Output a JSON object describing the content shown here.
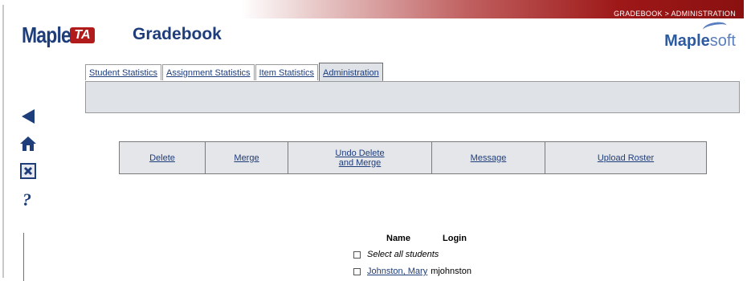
{
  "header": {
    "breadcrumb": "GRADEBOOK > ADMINISTRATION",
    "logo_text": "Maple",
    "logo_badge": "TA",
    "title": "Gradebook",
    "brand_bold": "Maple",
    "brand_rest": "soft"
  },
  "tabs": [
    {
      "label": "Student Statistics"
    },
    {
      "label": "Assignment Statistics"
    },
    {
      "label": "Item Statistics"
    },
    {
      "label": "Administration",
      "active": true
    }
  ],
  "sidebar": {
    "icons": [
      "back-icon",
      "home-icon",
      "close-icon",
      "help-icon"
    ]
  },
  "actions": [
    {
      "label": "Delete"
    },
    {
      "label": "Merge"
    },
    {
      "line1": "Undo Delete",
      "line2": "and Merge"
    },
    {
      "label": "Message"
    },
    {
      "label": "Upload Roster"
    }
  ],
  "students": {
    "col_name": "Name",
    "col_login": "Login",
    "select_all": "Select all students",
    "rows": [
      {
        "name": "Johnston, Mary",
        "login": "mjohnston"
      }
    ]
  },
  "colors": {
    "brand_blue": "#1e3d7b",
    "accent_red": "#9e1818",
    "panel_gray": "#dfe3e8"
  }
}
